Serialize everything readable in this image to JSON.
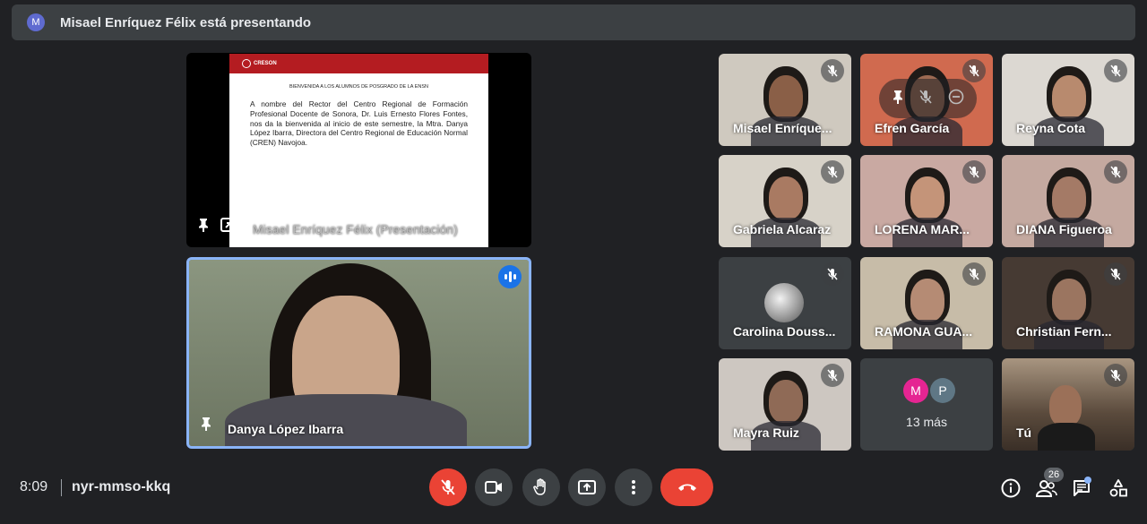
{
  "banner": {
    "avatar_letter": "M",
    "text": "Misael Enríquez Félix está presentando"
  },
  "presentation": {
    "label": "Misael Enríquez Félix (Presentación)",
    "slide_logo": "CRESON",
    "slide_heading": "BIENVENIDA A LOS ALUMNOS DE POSGRADO DE LA ENSN",
    "slide_body": "A nombre del Rector del Centro Regional de Formación Profesional Docente de Sonora, Dr. Luis Ernesto Flores Fontes, nos da la bienvenida al inicio de este semestre, la Mtra. Danya López Ibarra, Directora del Centro Regional de Educación Normal (CREN) Navojoa."
  },
  "speaker": {
    "name": "Danya López Ibarra"
  },
  "participants": [
    {
      "name": "Misael Enríque...",
      "bg": "#cfc9bf",
      "skin": "#8a5f47"
    },
    {
      "name": "Efren García",
      "bg": "#d06a4f",
      "skin": "#9c6a52"
    },
    {
      "name": "Reyna Cota",
      "bg": "#dcd8d2",
      "skin": "#b88a6e"
    },
    {
      "name": "Gabriela Alcaraz",
      "bg": "#d7d2c8",
      "skin": "#a97a62"
    },
    {
      "name": "LORENA MAR...",
      "bg": "#c9a9a2",
      "skin": "#c49479"
    },
    {
      "name": "DIANA Figueroa",
      "bg": "#c4a9a0",
      "skin": "#a47a66"
    },
    {
      "name": "Carolina Douss...",
      "bg": "#3c4043",
      "skin": "#dcdcdc"
    },
    {
      "name": "RAMONA GUA...",
      "bg": "#c7bca8",
      "skin": "#b58b74"
    },
    {
      "name": "Christian Fern...",
      "bg": "#463a33",
      "skin": "#9b7560"
    },
    {
      "name": "Mayra Ruiz",
      "bg": "#cdc7c1",
      "skin": "#8f6a56"
    }
  ],
  "more": {
    "avatars": [
      "M",
      "P"
    ],
    "avatar_colors": [
      "#e52592",
      "#5f7785"
    ],
    "label": "13 más"
  },
  "self_tile": {
    "name": "Tú",
    "bg": "#5a4a3c"
  },
  "bottom": {
    "time": "8:09",
    "meeting_code": "nyr-mmso-kkq",
    "participant_count": "26"
  },
  "colors": {
    "accent_blue": "#8ab4f8",
    "danger_red": "#ea4335",
    "surface": "#3c4043",
    "background": "#202124"
  }
}
